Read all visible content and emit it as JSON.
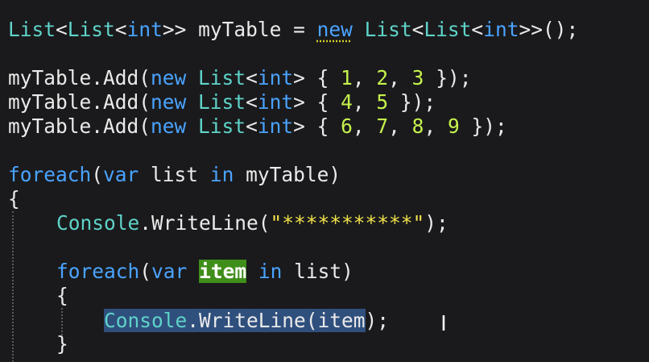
{
  "code": {
    "l1": {
      "a": "List",
      "b": "<",
      "c": "List",
      "d": "<",
      "e": "int",
      "f": ">> myTable = ",
      "g": "new",
      "h": " ",
      "i": "List",
      "j": "<",
      "k": "List",
      "l": "<",
      "m": "int",
      "n": ">>();"
    },
    "l2": {
      "a": "myTable.Add(",
      "b": "new",
      "c": " ",
      "d": "List",
      "e": "<",
      "f": "int",
      "g": "> { ",
      "h": "1",
      "i": ", ",
      "j": "2",
      "k": ", ",
      "l": "3",
      "m": " });"
    },
    "l3": {
      "a": "myTable.Add(",
      "b": "new",
      "c": " ",
      "d": "List",
      "e": "<",
      "f": "int",
      "g": "> { ",
      "h": "4",
      "i": ", ",
      "j": "5",
      "k": " });"
    },
    "l4": {
      "a": "myTable.Add(",
      "b": "new",
      "c": " ",
      "d": "List",
      "e": "<",
      "f": "int",
      "g": "> { ",
      "h": "6",
      "i": ", ",
      "j": "7",
      "k": ", ",
      "l": "8",
      "m": ", ",
      "n": "9",
      "o": " });"
    },
    "l5": {
      "a": "foreach",
      "b": "(",
      "c": "var",
      "d": " list ",
      "e": "in",
      "f": " myTable)"
    },
    "l6": {
      "a": "{"
    },
    "l7": {
      "a": "Console",
      "b": ".WriteLine(",
      "c": "\"***********\"",
      "d": ");"
    },
    "l8": {
      "a": "foreach",
      "b": "(",
      "c": "var",
      "d": " ",
      "e": "item",
      "f": " ",
      "g": "in",
      "h": " list)"
    },
    "l9": {
      "a": "{"
    },
    "l10": {
      "a": "Console",
      "b": ".WriteLine(",
      "c": "item",
      "d": ");"
    },
    "l11": {
      "a": "}"
    }
  },
  "cursor": {
    "glyph": "I"
  },
  "colors": {
    "background": "#1a1a1c",
    "type": "#5fd3c9",
    "keyword": "#4aa3ff",
    "number": "#c6f24d",
    "string": "#f0e14a",
    "word_highlight": "#3f8e1a",
    "selection": "#2f4f7d"
  }
}
